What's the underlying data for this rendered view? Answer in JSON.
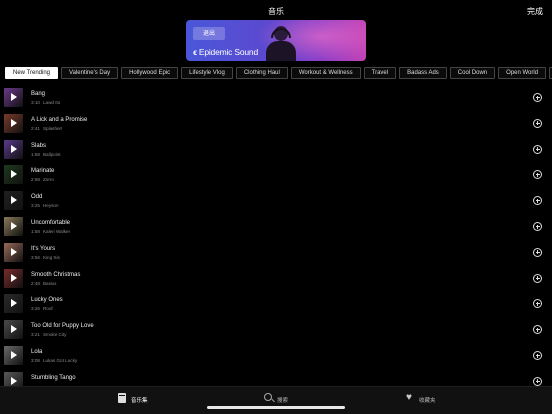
{
  "header": {
    "title": "音乐",
    "done_label": "完成"
  },
  "banner": {
    "exit_label": "退出",
    "brand_logo": "ϵ",
    "brand_name": "Epidemic Sound"
  },
  "categories": [
    {
      "label": "New Trending",
      "active": true
    },
    {
      "label": "Valentine's Day"
    },
    {
      "label": "Hollywood Epic"
    },
    {
      "label": "Lifestyle Vlog"
    },
    {
      "label": "Clothing Haul"
    },
    {
      "label": "Workout & Wellness"
    },
    {
      "label": "Travel"
    },
    {
      "label": "Badass Ads"
    },
    {
      "label": "Cool Down"
    },
    {
      "label": "Open World"
    },
    {
      "label": "C"
    }
  ],
  "songs": [
    {
      "title": "Bang",
      "duration": "3:10",
      "artist": "Lawd Ito",
      "thumb_color": "#6b3a8a"
    },
    {
      "title": "A Lick and a Promise",
      "duration": "2:41",
      "artist": "Splasher!",
      "thumb_color": "#7a3a2a"
    },
    {
      "title": "Slabs",
      "duration": "1:58",
      "artist": "Ballpoint",
      "thumb_color": "#5a3a8c"
    },
    {
      "title": "Marinate",
      "duration": "2:58",
      "artist": "Zorro",
      "thumb_color": "#1e3a1e"
    },
    {
      "title": "Odd",
      "duration": "3:25",
      "artist": "Heyson",
      "thumb_color": "#202020"
    },
    {
      "title": "Uncomfortable",
      "duration": "1:58",
      "artist": "Kaleri Walker",
      "thumb_color": "#8a7a5a"
    },
    {
      "title": "It's Yours",
      "duration": "3:56",
      "artist": "King Sis",
      "thumb_color": "#9a6a5a"
    },
    {
      "title": "Smooth Christmas",
      "duration": "2:48",
      "artist": "Basixx",
      "thumb_color": "#7a2a2a"
    },
    {
      "title": "Lucky Ones",
      "duration": "3:26",
      "artist": "Roof",
      "thumb_color": "#2a2a2a"
    },
    {
      "title": "Too Old for Puppy Love",
      "duration": "3:21",
      "artist": "Smoke City",
      "thumb_color": "#4a4a4a"
    },
    {
      "title": "Lola",
      "duration": "3:08",
      "artist": "Lukas Got Lucky",
      "thumb_color": "#6a6a6a"
    },
    {
      "title": "Stumbling Tango",
      "duration": "",
      "artist": "",
      "thumb_color": "#5a5a5a"
    }
  ],
  "tabbar": {
    "tabs": [
      {
        "label": "音乐集",
        "icon": "music-library-icon",
        "active": true
      },
      {
        "label": "搜索",
        "icon": "search-icon"
      },
      {
        "label": "收藏夹",
        "icon": "heart-icon"
      }
    ]
  },
  "colors": {
    "background": "#000000",
    "banner_start": "#4a57d8",
    "banner_end": "#c343b6",
    "active_chip": "#ffffff"
  }
}
